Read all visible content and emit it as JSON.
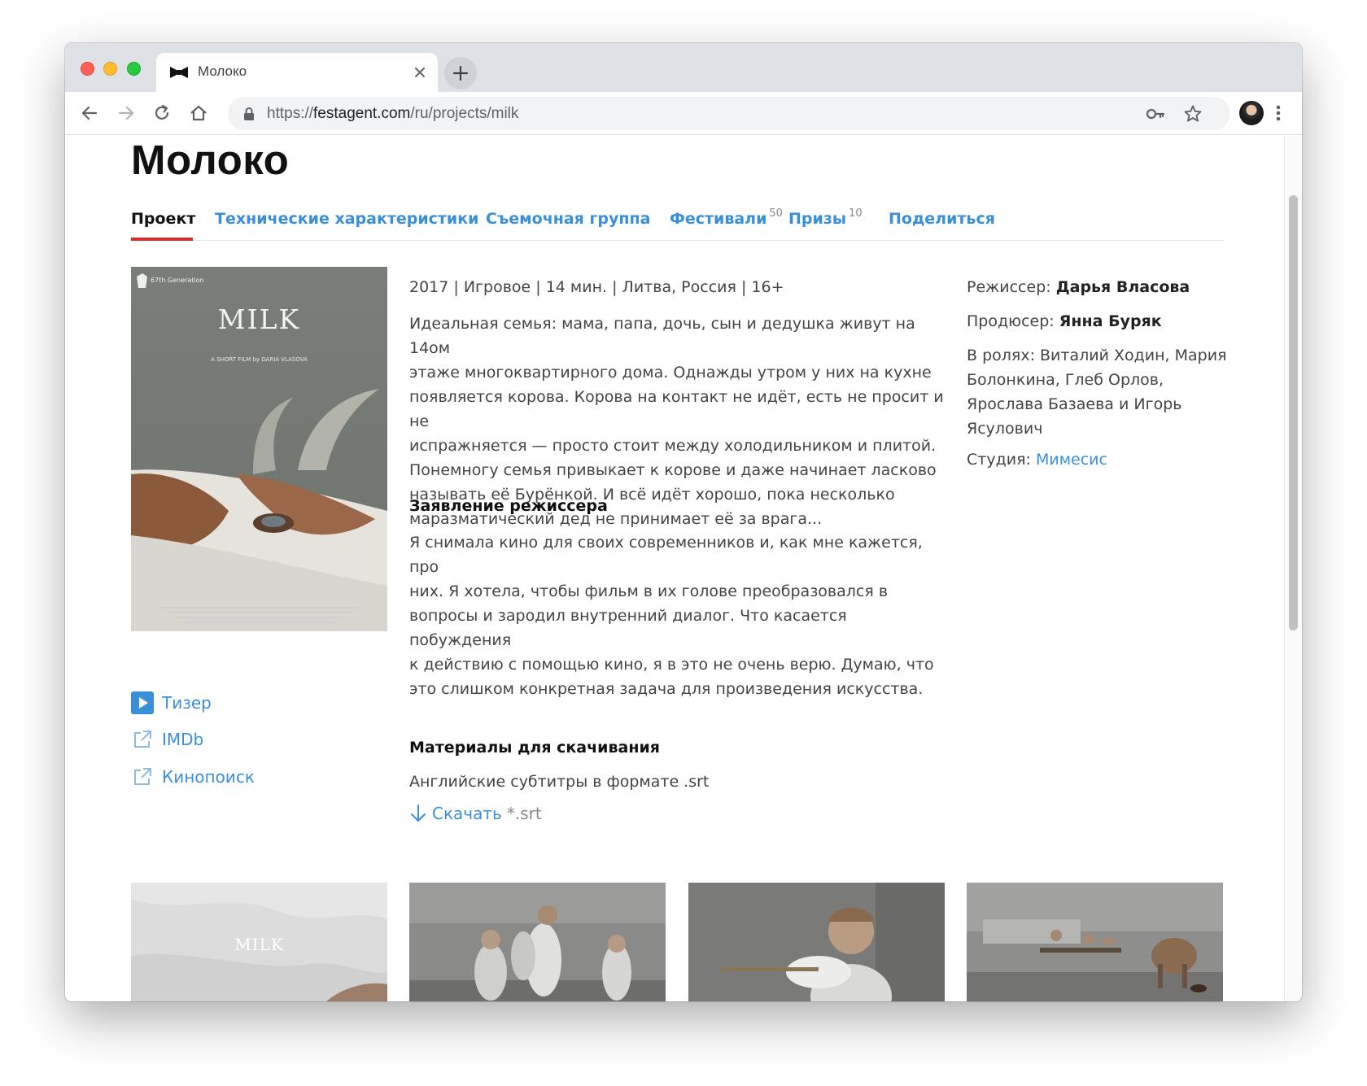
{
  "browser": {
    "tab_title": "Молоко",
    "url_prefix": "https://",
    "url_domain": "festagent.com",
    "url_path": "/ru/projects/milk"
  },
  "page": {
    "title": "Молоко",
    "nav": [
      {
        "label": "Проект",
        "active": true
      },
      {
        "label": "Технические характеристики"
      },
      {
        "label": "Съемочная группа"
      },
      {
        "label": "Фестивали",
        "count": "50"
      },
      {
        "label": "Призы",
        "count": "10"
      },
      {
        "label": "Поделиться"
      }
    ],
    "poster": {
      "title": "MILK",
      "subtitle": "A SHORT FILM by DARIA VLASOVA",
      "festival_badge": "67th Generation"
    },
    "links": {
      "teaser": "Тизер",
      "imdb": "IMDb",
      "kinopoisk": "Кинопоиск"
    },
    "meta_line": "2017 | Игровое | 14 мин. | Литва, Россия | 16+",
    "synopsis": [
      "Идеальная семья: мама, папа, дочь, сын и дедушка живут на 14ом",
      "этаже многоквартирного дома. Однажды утром у них на кухне",
      "появляется корова. Корова на контакт не идёт, есть не просит и не",
      "испражняется — просто стоит между холодильником и плитой.",
      "Понемногу семья привыкает к корове и даже начинает ласково",
      "называть её Бурёнкой. И всё идёт хорошо, пока несколько",
      "маразматический дед не принимает её за врага..."
    ],
    "director_statement_heading": "Заявление режиссера",
    "director_statement": [
      "Я снимала кино для своих современников и, как мне кажется, про",
      "них. Я хотела, чтобы фильм в их голове преобразовался в",
      "вопросы и зародил внутренний диалог. Что касается побуждения",
      "к действию с помощью кино, я в это не очень верю. Думаю, что",
      "это слишком конкретная задача для произведения искусства."
    ],
    "downloads_heading": "Материалы для скачивания",
    "downloads_desc": "Английские субтитры в формате .srt",
    "download_label": "Скачать",
    "download_ext": "*.srt",
    "credits": {
      "director_label": "Режиссер:",
      "director": "Дарья Власова",
      "producer_label": "Продюсер:",
      "producer": "Янна Буряк",
      "cast_lines": [
        "В ролях: Виталий Ходин, Мария",
        "Болонкина, Глеб Орлов,",
        "Ярослава Базаева и Игорь",
        "Ясулович"
      ],
      "studio_label": "Студия:",
      "studio": "Мимесис"
    },
    "gallery": {
      "first_thumb_text": "MILK",
      "active_dot": 1,
      "dot_count": 2
    },
    "colors": {
      "link": "#3a8fd9",
      "active_underline": "#d0312d",
      "dot_active": "#3a8fd9",
      "dot_inactive": "#cccccc"
    }
  }
}
